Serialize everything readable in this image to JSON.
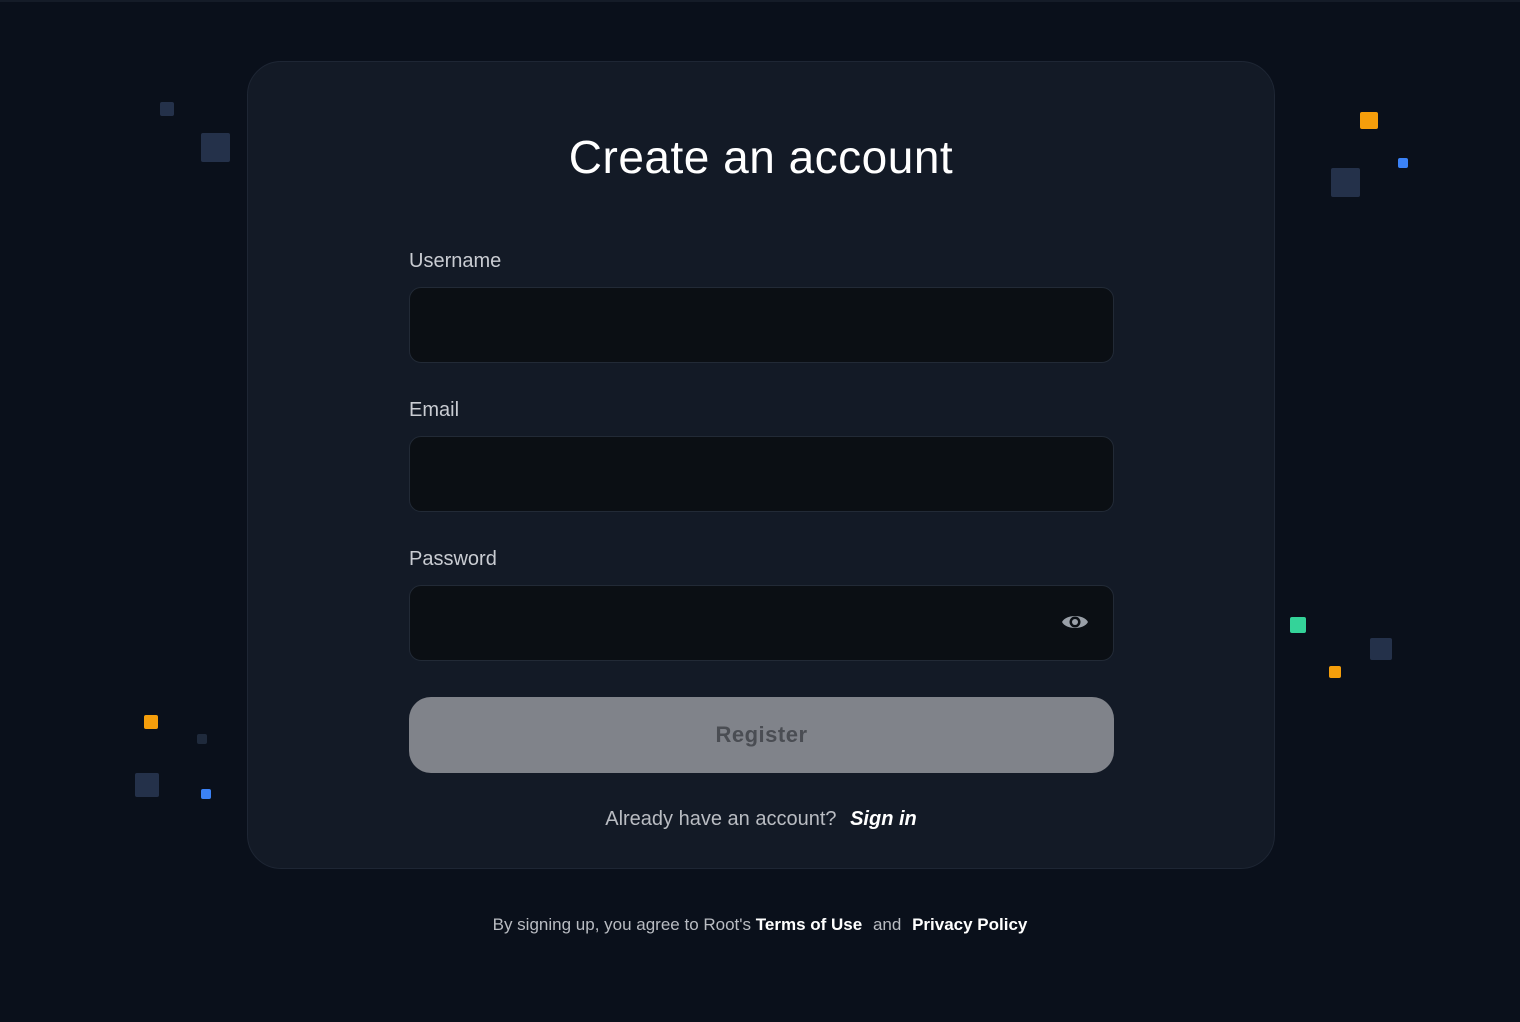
{
  "form": {
    "title": "Create an account",
    "username_label": "Username",
    "username_value": "",
    "email_label": "Email",
    "email_value": "",
    "password_label": "Password",
    "password_value": "",
    "register_label": "Register",
    "signin_prompt": "Already have an account?",
    "signin_link": "Sign in"
  },
  "footer": {
    "prefix": "By signing up, you agree to Root's",
    "terms": "Terms of Use",
    "and": "and",
    "privacy": "Privacy Policy"
  },
  "colors": {
    "background": "#0a101b",
    "card": "#131a26",
    "input": "#0b0f14",
    "button_disabled": "#80838a",
    "accent_orange": "#f59e0b",
    "accent_blue": "#3b82f6",
    "accent_green": "#34d399",
    "accent_navy": "#24314a"
  },
  "icons": {
    "password_toggle": "eye-icon"
  }
}
